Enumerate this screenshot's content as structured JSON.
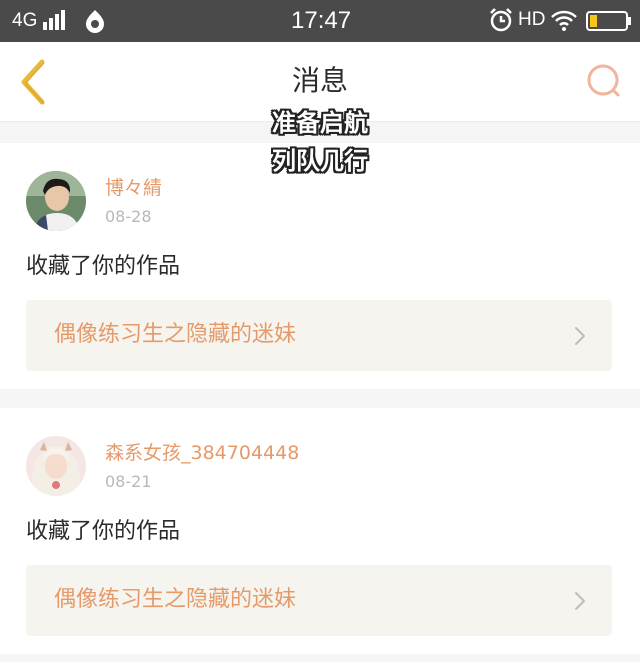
{
  "status_bar": {
    "network": "4G",
    "time": "17:47",
    "hd": "HD",
    "icons": [
      "signal-icon",
      "app-icon",
      "alarm-icon",
      "wifi-icon",
      "battery-icon"
    ]
  },
  "header": {
    "title": "消息",
    "back_icon": "chevron-left-icon",
    "search_icon": "search-icon"
  },
  "overlay": {
    "line1": "准备启航",
    "line2": "列队几行"
  },
  "messages": [
    {
      "username": "博々綪",
      "date": "08-28",
      "action": "收藏了你的作品",
      "work_title": "偶像练习生之隐藏的迷妹"
    },
    {
      "username": "森系女孩_384704448",
      "date": "08-21",
      "action": "收藏了你的作品",
      "work_title": "偶像练习生之隐藏的迷妹"
    }
  ],
  "colors": {
    "accent": "#e69a6a",
    "back_arrow": "#e8b93a",
    "status_bar": "#4a4a4a",
    "link_bg": "#f6f4ee"
  }
}
